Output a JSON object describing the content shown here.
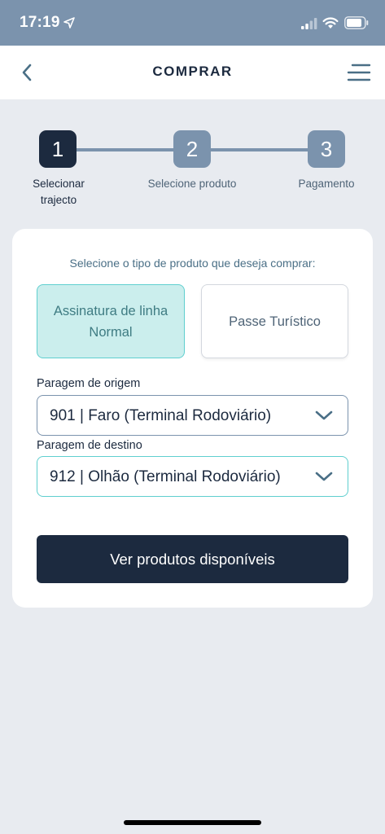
{
  "status_bar": {
    "time": "17:19",
    "icons": [
      "location-arrow-icon",
      "signal-icon",
      "wifi-icon",
      "battery-icon"
    ]
  },
  "header": {
    "title": "COMPRAR",
    "back_icon": "chevron-left-icon",
    "menu_icon": "hamburger-menu-icon"
  },
  "stepper": {
    "steps": [
      {
        "number": "1",
        "label_line1": "Selecionar",
        "label_line2": "trajecto",
        "active": true
      },
      {
        "number": "2",
        "label_line1": "Selecione produto",
        "label_line2": "",
        "active": false
      },
      {
        "number": "3",
        "label_line1": "Pagamento",
        "label_line2": "",
        "active": false
      }
    ]
  },
  "form": {
    "prompt": "Selecione o tipo de produto que deseja comprar:",
    "product_types": [
      {
        "label_line1": "Assinatura de linha",
        "label_line2": "Normal",
        "selected": true
      },
      {
        "label_line1": "Passe Turístico",
        "label_line2": "",
        "selected": false
      }
    ],
    "origin": {
      "label": "Paragem de origem",
      "value": "901 | Faro (Terminal Rodoviário)"
    },
    "destination": {
      "label": "Paragem de destino",
      "value": "912 | Olhão (Terminal Rodoviário)"
    },
    "submit_label": "Ver produtos disponíveis"
  },
  "colors": {
    "accent_dark": "#1c2a3f",
    "accent_slate": "#7b93ad",
    "accent_teal": "#5fcfcf",
    "selected_bg": "#cbeeed",
    "page_bg": "#e8ebf0"
  }
}
